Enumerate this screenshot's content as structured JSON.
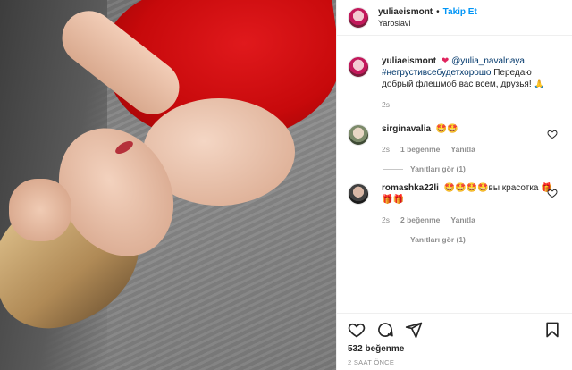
{
  "header": {
    "username": "yuliaeismont",
    "separator": "•",
    "follow_label": "Takip Et",
    "location": "Yaroslavl"
  },
  "caption": {
    "username": "yuliaeismont",
    "mention": "@yulia_navalnaya",
    "hashtag": "#негрустивсебудетхорошо",
    "text": "Передаю добрый флешмоб вас всем, друзья!",
    "emoji": "🙏",
    "time": "2s"
  },
  "comments": [
    {
      "username": "sirginavalia",
      "text": "🤩🤩",
      "time": "2s",
      "likes": "1 beğenme",
      "reply": "Yanıtla",
      "view_replies": "Yanıtları gör (1)"
    },
    {
      "username": "romashka22li",
      "text": "🤩🤩🤩🤩вы красотка 🎁🎁🎁",
      "time": "2s",
      "likes": "2 beğenme",
      "reply": "Yanıtla",
      "view_replies": "Yanıtları gör (1)"
    }
  ],
  "footer": {
    "likes": "532 beğenme",
    "timestamp": "2 SAAT ÖNCE"
  }
}
